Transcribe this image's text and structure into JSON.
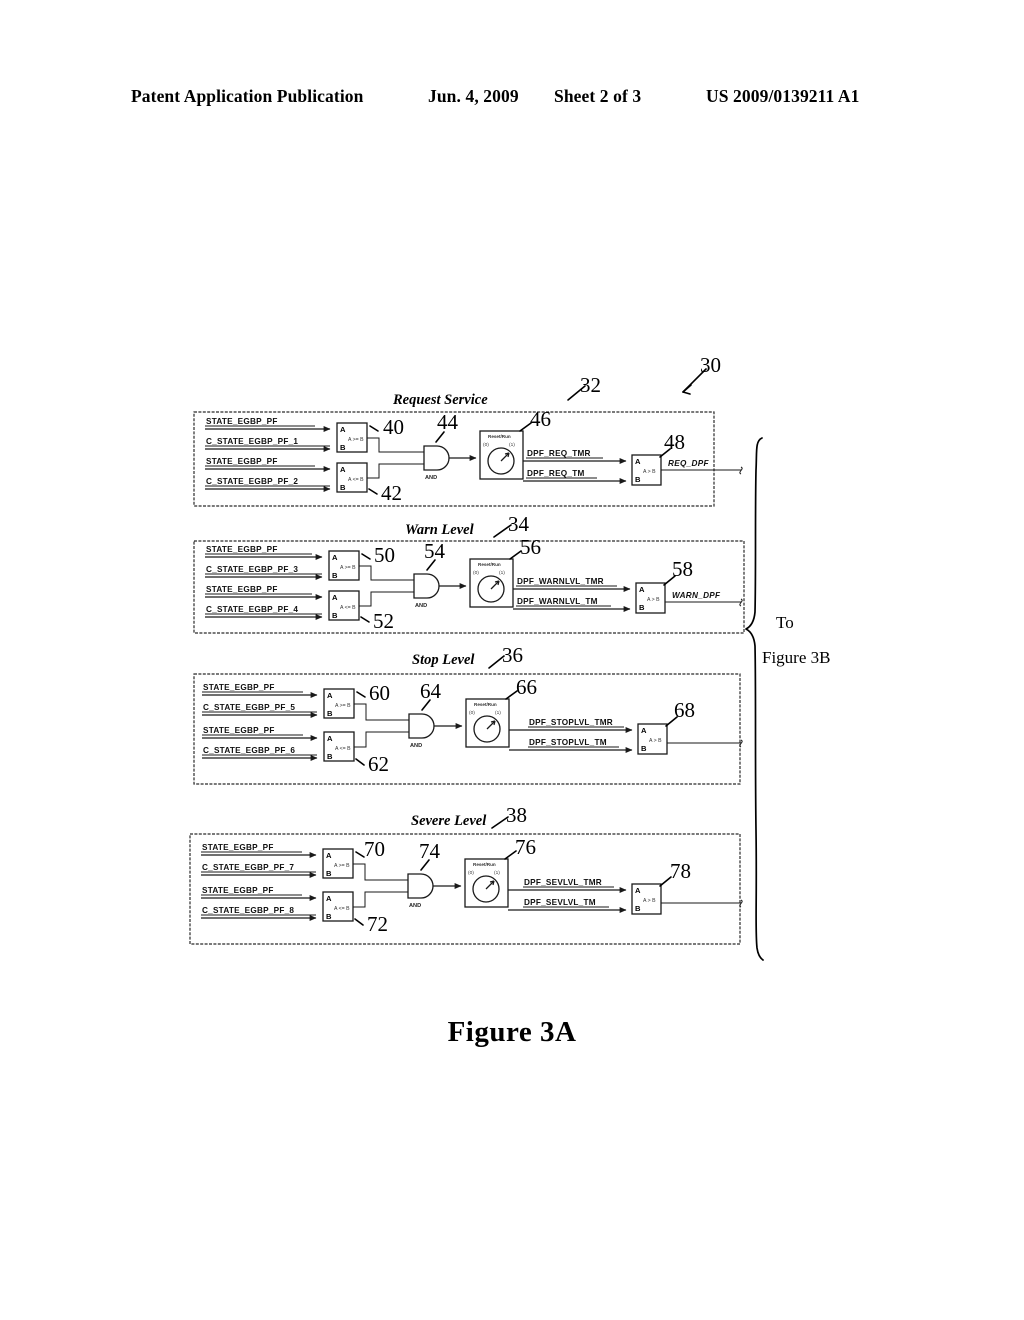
{
  "header": {
    "publication": "Patent Application Publication",
    "date": "Jun. 4, 2009",
    "sheet": "Sheet 2 of 3",
    "patent_number": "US 2009/0139211 A1"
  },
  "figure": {
    "caption": "Figure 3A",
    "overall_ref": "30",
    "continuation_note_line1": "To",
    "continuation_note_line2": "Figure 3B"
  },
  "common": {
    "state_signal": "STATE_EGBP_PF",
    "and_gate_label": "AND",
    "timer_title": "Reset/Run",
    "timer_port_0": "(0)",
    "timer_port_1": "(1)",
    "port_a": "A",
    "port_b": "B",
    "op_ge": "A >= B",
    "op_le": "A <= B",
    "op_gt": "A > B"
  },
  "blocks": [
    {
      "title": "Request Service",
      "ref": "32",
      "comparators": [
        {
          "ref": "40",
          "input_a": "STATE_EGBP_PF",
          "input_b": "C_STATE_EGBP_PF_1",
          "op": "A >= B"
        },
        {
          "ref": "42",
          "input_a": "STATE_EGBP_PF",
          "input_b": "C_STATE_EGBP_PF_2",
          "op": "A <= B"
        }
      ],
      "and_gate": {
        "ref": "44",
        "label": "AND"
      },
      "timer": {
        "ref": "46",
        "title": "Reset/Run",
        "port_0": "(0)",
        "port_1": "(1)"
      },
      "timer_out_a": "DPF_REQ_TMR",
      "timer_out_b": "DPF_REQ_TM",
      "output_comparator": {
        "ref": "48",
        "op": "A > B"
      },
      "output_signal": "REQ_DPF"
    },
    {
      "title": "Warn Level",
      "ref": "34",
      "comparators": [
        {
          "ref": "50",
          "input_a": "STATE_EGBP_PF",
          "input_b": "C_STATE_EGBP_PF_3",
          "op": "A >= B"
        },
        {
          "ref": "52",
          "input_a": "STATE_EGBP_PF",
          "input_b": "C_STATE_EGBP_PF_4",
          "op": "A <= B"
        }
      ],
      "and_gate": {
        "ref": "54",
        "label": "AND"
      },
      "timer": {
        "ref": "56",
        "title": "Reset/Run",
        "port_0": "(0)",
        "port_1": "(1)"
      },
      "timer_out_a": "DPF_WARNLVL_TMR",
      "timer_out_b": "DPF_WARNLVL_TM",
      "output_comparator": {
        "ref": "58",
        "op": "A > B"
      },
      "output_signal": "WARN_DPF"
    },
    {
      "title": "Stop Level",
      "ref": "36",
      "comparators": [
        {
          "ref": "60",
          "input_a": "STATE_EGBP_PF",
          "input_b": "C_STATE_EGBP_PF_5",
          "op": "A >= B"
        },
        {
          "ref": "62",
          "input_a": "STATE_EGBP_PF",
          "input_b": "C_STATE_EGBP_PF_6",
          "op": "A <= B"
        }
      ],
      "and_gate": {
        "ref": "64",
        "label": "AND"
      },
      "timer": {
        "ref": "66",
        "title": "Reset/Run",
        "port_0": "(0)",
        "port_1": "(1)"
      },
      "timer_out_a": "DPF_STOPLVL_TMR",
      "timer_out_b": "DPF_STOPLVL_TM",
      "output_comparator": {
        "ref": "68",
        "op": "A > B"
      },
      "output_signal": ""
    },
    {
      "title": "Severe Level",
      "ref": "38",
      "comparators": [
        {
          "ref": "70",
          "input_a": "STATE_EGBP_PF",
          "input_b": "C_STATE_EGBP_PF_7",
          "op": "A >= B"
        },
        {
          "ref": "72",
          "input_a": "STATE_EGBP_PF",
          "input_b": "C_STATE_EGBP_PF_8",
          "op": "A <= B"
        }
      ],
      "and_gate": {
        "ref": "74",
        "label": "AND"
      },
      "timer": {
        "ref": "76",
        "title": "Reset/Run",
        "port_0": "(0)",
        "port_1": "(1)"
      },
      "timer_out_a": "DPF_SEVLVL_TMR",
      "timer_out_b": "DPF_SEVLVL_TM",
      "output_comparator": {
        "ref": "78",
        "op": "A > B"
      },
      "output_signal": ""
    }
  ]
}
